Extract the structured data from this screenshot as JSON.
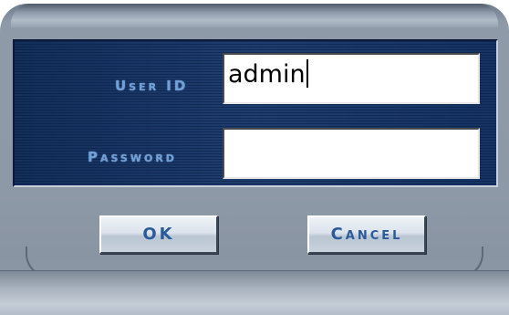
{
  "login": {
    "user_id_label": "User ID",
    "user_id_value": "admin",
    "password_label": "Password",
    "password_value": ""
  },
  "buttons": {
    "ok_label": "OK",
    "cancel_label": "Cancel"
  },
  "colors": {
    "panel_blue": "#163260",
    "label_blue": "#6fa0d8",
    "button_text": "#2a5a9a",
    "frame_gray": "#8e9aa8"
  }
}
